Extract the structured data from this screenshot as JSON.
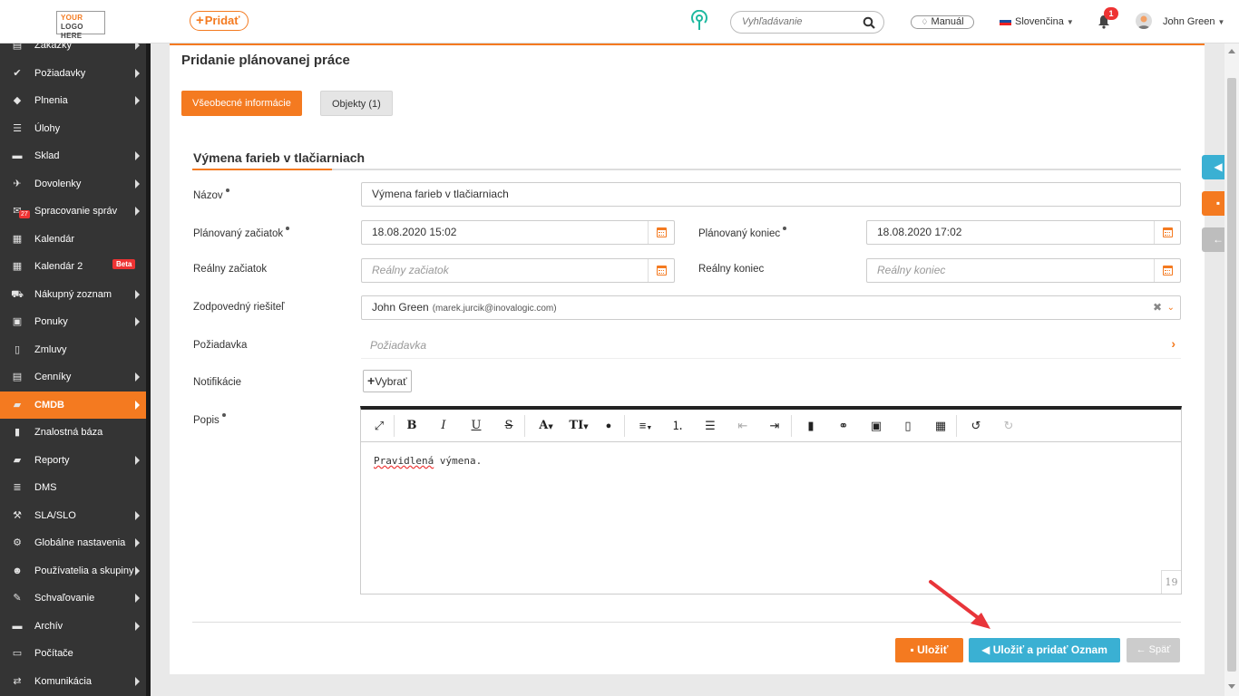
{
  "header": {
    "logo": {
      "line1a": "YOUR",
      "line1b": "LOGO",
      "line2": "HERE"
    },
    "add_label": "Pridať",
    "search_placeholder": "Vyhľadávanie",
    "manual_label": "Manuál",
    "language": "Slovenčina",
    "notifications_count": "1",
    "user_name": "John Green"
  },
  "sidebar": {
    "items": [
      {
        "label": "Zákazky",
        "icon": "document-icon",
        "arrow": true
      },
      {
        "label": "Požiadavky",
        "icon": "check-circle-icon",
        "arrow": true
      },
      {
        "label": "Plnenia",
        "icon": "cubes-icon",
        "arrow": true
      },
      {
        "label": "Úlohy",
        "icon": "list-icon",
        "arrow": false
      },
      {
        "label": "Sklad",
        "icon": "archive-icon",
        "arrow": true
      },
      {
        "label": "Dovolenky",
        "icon": "plane-icon",
        "arrow": true
      },
      {
        "label": "Spracovanie správ",
        "icon": "envelope-icon",
        "arrow": true,
        "count": "27"
      },
      {
        "label": "Kalendár",
        "icon": "calendar-icon",
        "arrow": false
      },
      {
        "label": "Kalendár 2",
        "icon": "calendar-icon",
        "arrow": false,
        "badge": "Beta"
      },
      {
        "label": "Nákupný zoznam",
        "icon": "cart-icon",
        "arrow": true
      },
      {
        "label": "Ponuky",
        "icon": "gift-icon",
        "arrow": true
      },
      {
        "label": "Zmluvy",
        "icon": "file-icon",
        "arrow": false
      },
      {
        "label": "Cenníky",
        "icon": "pricelist-icon",
        "arrow": true
      },
      {
        "label": "CMDB",
        "icon": "folder-open-icon",
        "arrow": true,
        "active": true
      },
      {
        "label": "Znalostná báza",
        "icon": "book-icon",
        "arrow": false
      },
      {
        "label": "Reporty",
        "icon": "folder-icon",
        "arrow": true
      },
      {
        "label": "DMS",
        "icon": "database-icon",
        "arrow": false
      },
      {
        "label": "SLA/SLO",
        "icon": "gavel-icon",
        "arrow": true
      },
      {
        "label": "Globálne nastavenia",
        "icon": "cogs-icon",
        "arrow": true
      },
      {
        "label": "Používatelia a skupiny",
        "icon": "users-icon",
        "arrow": true
      },
      {
        "label": "Schvaľovanie",
        "icon": "thumbtack-icon",
        "arrow": true
      },
      {
        "label": "Archív",
        "icon": "archive-icon",
        "arrow": true
      },
      {
        "label": "Počítače",
        "icon": "laptop-icon",
        "arrow": false
      },
      {
        "label": "Komunikácia",
        "icon": "exchange-icon",
        "arrow": true
      }
    ]
  },
  "page": {
    "title": "Pridanie plánovanej práce",
    "tabs": [
      {
        "label": "Všeobecné informácie",
        "active": true
      },
      {
        "label": "Objekty (1)",
        "active": false
      }
    ],
    "section_title": "Výmena farieb v tlačiarniach"
  },
  "form": {
    "name_label": "Názov",
    "name_value": "Výmena farieb v tlačiarniach",
    "planned_start_label": "Plánovaný začiatok",
    "planned_start_value": "18.08.2020 15:02",
    "planned_end_label": "Plánovaný koniec",
    "planned_end_value": "18.08.2020 17:02",
    "real_start_label": "Reálny začiatok",
    "real_start_placeholder": "Reálny začiatok",
    "real_end_label": "Reálny koniec",
    "real_end_placeholder": "Reálny koniec",
    "responsible_label": "Zodpovedný riešiteľ",
    "responsible_name": "John Green",
    "responsible_email": "(marek.jurcik@inovalogic.com)",
    "request_label": "Požiadavka",
    "request_placeholder": "Požiadavka",
    "notifications_label": "Notifikácie",
    "select_button": "Vybrať",
    "description_label": "Popis",
    "description_word1": "Pravidlená",
    "description_rest": " výmena.",
    "word_count": "19"
  },
  "buttons": {
    "save": "Uložiť",
    "save_and_announce": "Uložiť a pridať Oznam",
    "back": "Späť"
  },
  "colors": {
    "accent": "#f47a20",
    "info": "#3ab0d3",
    "sidebar_bg": "#343434"
  }
}
